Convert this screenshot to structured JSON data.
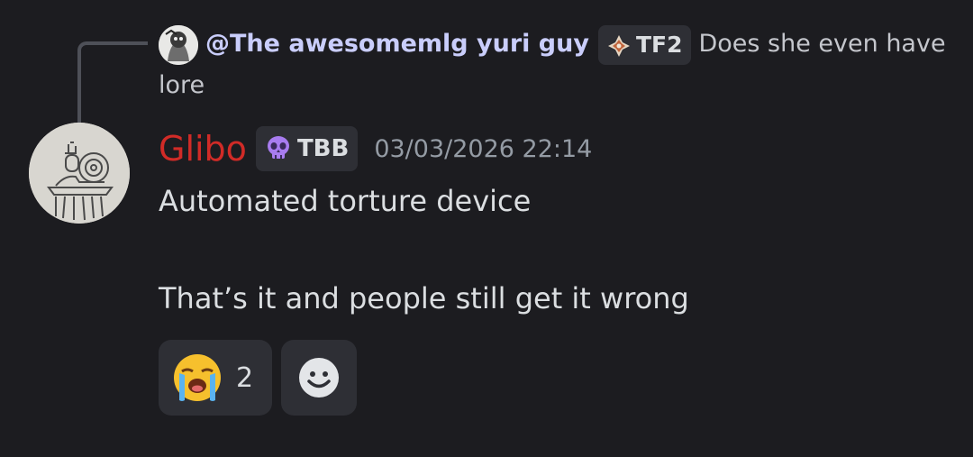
{
  "reply": {
    "author": "@The awesomemlg yuri guy",
    "tag": "TF2",
    "text": "Does she even have lore"
  },
  "message": {
    "author": "Glibo",
    "author_color": "#d12b27",
    "tag": "TBB",
    "timestamp": "03/03/2026 22:14",
    "lines": [
      "Automated torture device",
      "That’s it and people still get it wrong"
    ]
  },
  "reactions": [
    {
      "emoji": "loudly-crying-face",
      "count": "2"
    }
  ],
  "add_reaction_icon": "smiley-add-icon"
}
